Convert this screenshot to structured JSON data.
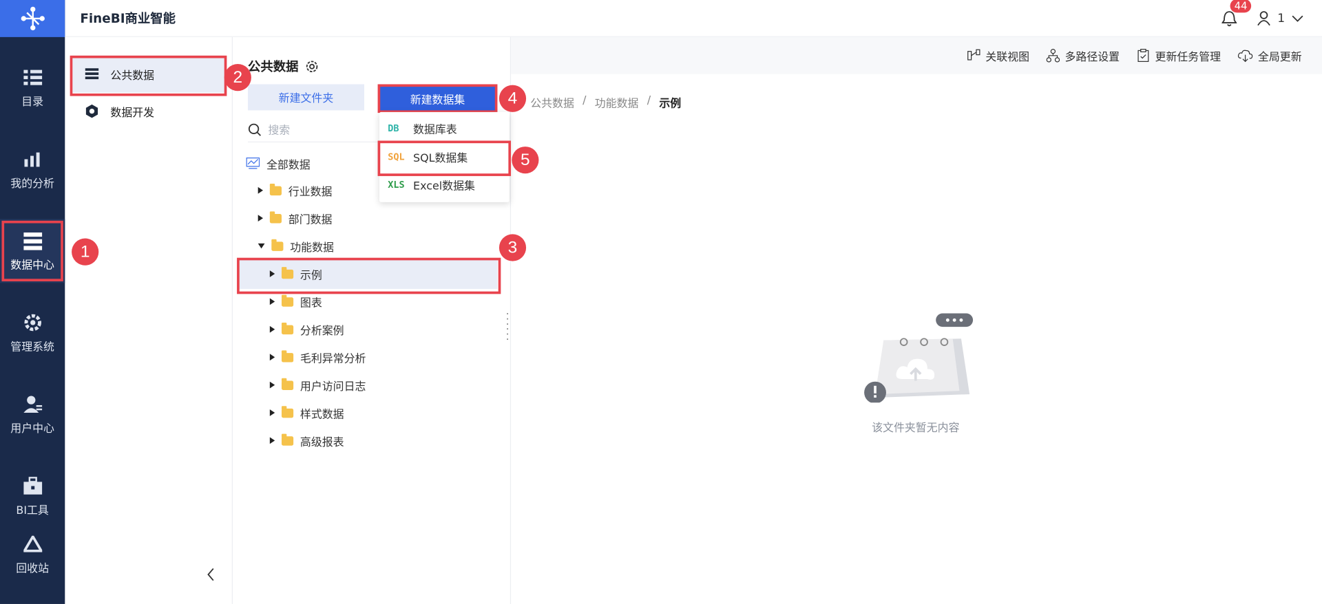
{
  "app": {
    "title": "FineBI商业智能"
  },
  "topbar": {
    "notification_count": "44",
    "user_name": "1"
  },
  "leftnav": {
    "items": [
      {
        "label": "目录",
        "icon": "catalog-icon"
      },
      {
        "label": "我的分析",
        "icon": "analysis-icon"
      },
      {
        "label": "数据中心",
        "icon": "data-center-icon",
        "active": true
      },
      {
        "label": "管理系统",
        "icon": "gear-icon"
      },
      {
        "label": "用户中心",
        "icon": "user-icon"
      },
      {
        "label": "BI工具",
        "icon": "toolbox-icon"
      },
      {
        "label": "回收站",
        "icon": "recycle-icon"
      }
    ]
  },
  "datacenter_menu": {
    "items": [
      {
        "label": "公共数据",
        "active": true
      },
      {
        "label": "数据开发"
      }
    ]
  },
  "public_data": {
    "title": "公共数据",
    "new_folder_label": "新建文件夹",
    "new_dataset_label": "新建数据集",
    "search_placeholder": "搜索",
    "tree": {
      "root": "全部数据",
      "items": [
        {
          "label": "行业数据",
          "level": 1
        },
        {
          "label": "部门数据",
          "level": 1
        },
        {
          "label": "功能数据",
          "level": 1,
          "expanded": true
        },
        {
          "label": "示例",
          "level": 2,
          "selected": true
        },
        {
          "label": "图表",
          "level": 2
        },
        {
          "label": "分析案例",
          "level": 2
        },
        {
          "label": "毛利异常分析",
          "level": 2
        },
        {
          "label": "用户访问日志",
          "level": 2
        },
        {
          "label": "样式数据",
          "level": 2
        },
        {
          "label": "高级报表",
          "level": 2
        }
      ]
    }
  },
  "dataset_dropdown": {
    "items": [
      {
        "label": "数据库表",
        "icon_text": "DB",
        "color": "#2eb3a8"
      },
      {
        "label": "SQL数据集",
        "icon_text": "SQL",
        "color": "#f0a23b"
      },
      {
        "label": "Excel数据集",
        "icon_text": "XLS",
        "color": "#2e9c4a"
      }
    ]
  },
  "toolbar": {
    "items": [
      {
        "label": "关联视图",
        "icon": "relation-view-icon"
      },
      {
        "label": "多路径设置",
        "icon": "multi-path-icon"
      },
      {
        "label": "更新任务管理",
        "icon": "task-icon"
      },
      {
        "label": "全局更新",
        "icon": "cloud-update-icon"
      }
    ]
  },
  "breadcrumb": {
    "items": [
      "公共数据",
      "功能数据",
      "示例"
    ]
  },
  "empty_state": {
    "text": "该文件夹暂无内容"
  },
  "markers": [
    "1",
    "2",
    "3",
    "4",
    "5"
  ],
  "colors": {
    "accent": "#2f5fdc",
    "nav_bg": "#1a2a4a",
    "highlight": "#e8434d"
  }
}
